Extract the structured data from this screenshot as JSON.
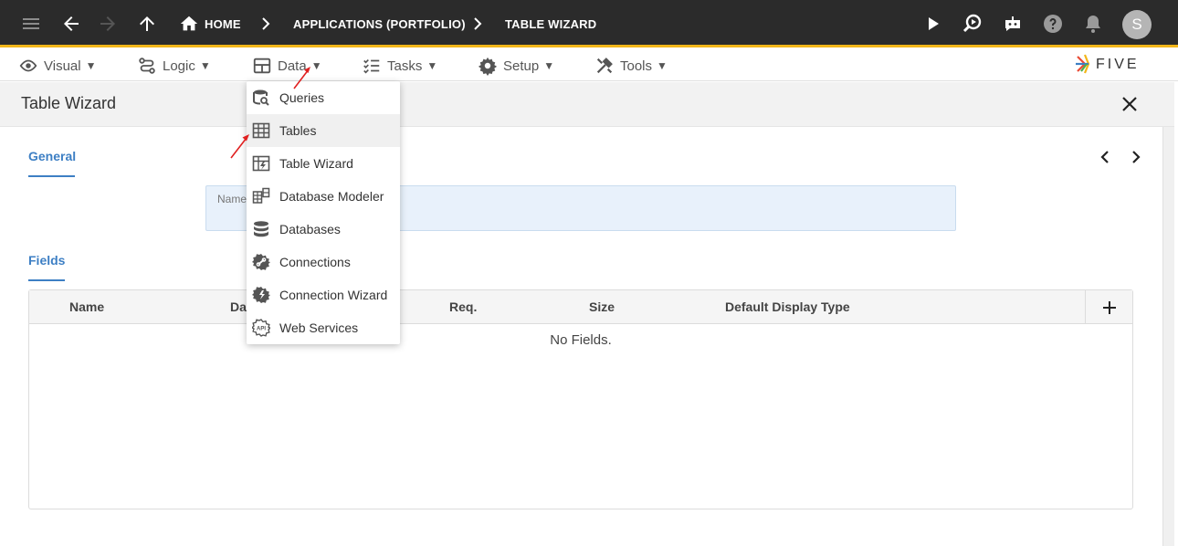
{
  "topbar": {
    "breadcrumbs": [
      {
        "label": "HOME"
      },
      {
        "label": "APPLICATIONS (PORTFOLIO)"
      },
      {
        "label": "TABLE WIZARD"
      }
    ],
    "avatar_initial": "S",
    "accent_color": "#f2b619"
  },
  "menubar": {
    "items": [
      {
        "label": "Visual",
        "icon": "eye-icon"
      },
      {
        "label": "Logic",
        "icon": "logic-icon"
      },
      {
        "label": "Data",
        "icon": "table-icon"
      },
      {
        "label": "Tasks",
        "icon": "tasks-icon"
      },
      {
        "label": "Setup",
        "icon": "gear-icon"
      },
      {
        "label": "Tools",
        "icon": "tools-icon"
      }
    ],
    "caret": "▼",
    "logo_text": "FIVE"
  },
  "data_menu": {
    "items": [
      {
        "label": "Queries",
        "icon": "queries-icon"
      },
      {
        "label": "Tables",
        "icon": "tables-icon",
        "highlighted": true
      },
      {
        "label": "Table Wizard",
        "icon": "table-wizard-icon"
      },
      {
        "label": "Database Modeler",
        "icon": "database-modeler-icon"
      },
      {
        "label": "Databases",
        "icon": "databases-icon"
      },
      {
        "label": "Connections",
        "icon": "connections-icon"
      },
      {
        "label": "Connection Wizard",
        "icon": "connection-wizard-icon"
      },
      {
        "label": "Web Services",
        "icon": "web-services-icon"
      }
    ]
  },
  "panel": {
    "title": "Table Wizard",
    "general_tab": "General",
    "name_label": "Name",
    "fields_tab": "Fields"
  },
  "fields_table": {
    "columns": [
      "Name",
      "Da",
      "Req.",
      "Size",
      "Default Display Type"
    ],
    "empty_text": "No Fields."
  }
}
